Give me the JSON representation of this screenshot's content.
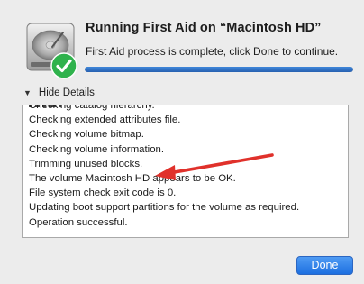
{
  "dialog": {
    "title": "Running First Aid on “Macintosh HD”",
    "subtitle": "First Aid process is complete, click Done to continue.",
    "progress": 1.0
  },
  "details": {
    "toggle_label": "Hide Details",
    "toggle_icon": "disclosure-triangle-down-icon"
  },
  "log": {
    "lines": [
      "Checking catalog hierarchy.",
      "Checking extended attributes file.",
      "Checking volume bitmap.",
      "Checking volume information.",
      "Trimming unused blocks.",
      "The volume Macintosh HD appears to be OK.",
      "File system check exit code is 0.",
      "Updating boot support partitions for the volume as required.",
      "Operation successful."
    ]
  },
  "buttons": {
    "done_label": "Done"
  },
  "colors": {
    "accent": "#2a6fdb",
    "checkmark": "#2fb24c",
    "annotation_arrow": "#e0312b"
  }
}
